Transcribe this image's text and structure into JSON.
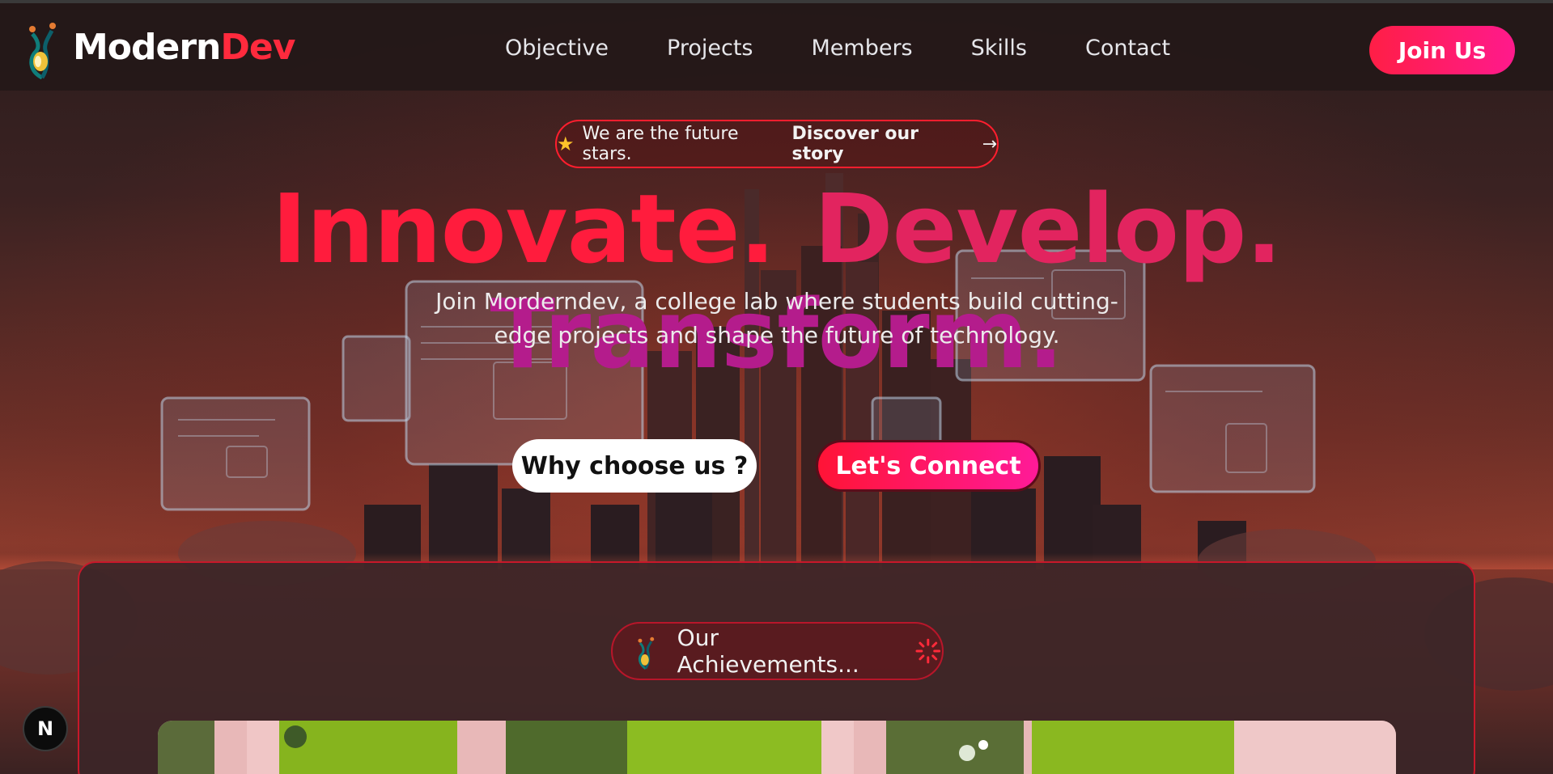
{
  "brand": {
    "name_part1": "Modern",
    "name_part2": "Dev"
  },
  "nav": {
    "items": [
      {
        "label": "Objective"
      },
      {
        "label": "Projects"
      },
      {
        "label": "Members"
      },
      {
        "label": "Skills"
      },
      {
        "label": "Contact"
      }
    ],
    "join_label": "Join Us"
  },
  "announcement": {
    "icon": "star-icon",
    "text": "We are the future stars.",
    "link_text": "Discover our story",
    "arrow": "→"
  },
  "hero": {
    "headline": [
      "Innovate.",
      "Develop.",
      "Transform."
    ],
    "subtitle": "Join Morderndev, a college lab where students build cutting-edge projects and shape the future of technology.",
    "cta_primary": "Why choose us ?",
    "cta_secondary": "Let's Connect"
  },
  "achievements": {
    "label": "Our Achievements..."
  },
  "dev_badge": {
    "letter": "N"
  },
  "colors": {
    "accent_red": "#ff1c3d",
    "accent_pink": "#ff1a98",
    "accent_magenta": "#b41c8c",
    "navbar_bg": "#241818",
    "card_border": "#c8182a"
  }
}
